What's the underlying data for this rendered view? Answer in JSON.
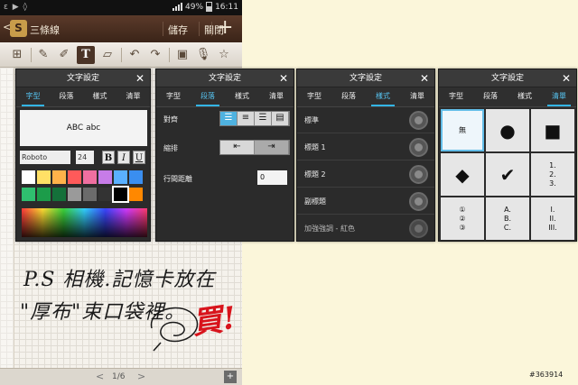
{
  "status_bar": {
    "notifications": "ε ▶ ◊",
    "battery": "49%",
    "time": "16:11"
  },
  "app_bar": {
    "back_glyph": "<",
    "title": "三條線",
    "save_label": "儲存",
    "close_label": "關閉",
    "add_glyph": "+"
  },
  "toolbar": {
    "tools": [
      "insert-page-icon",
      "pen-icon",
      "brush-icon",
      "text-icon",
      "eraser-icon",
      "undo-icon",
      "redo-icon",
      "image-icon",
      "mic-icon",
      "star-icon"
    ],
    "text_tool_glyph": "T"
  },
  "handwriting": {
    "line1": "P.S 相機.記憶卡放在",
    "line2": "\"厚布\"束口袋裡。",
    "exclaim": "買!"
  },
  "pager": {
    "page": "1/6",
    "prev_glyph": "<",
    "next_glyph": ">",
    "add_glyph": "+"
  },
  "dialogs": {
    "title": "文字設定",
    "close_glyph": "✕",
    "tabs": [
      "字型",
      "段落",
      "樣式",
      "清單"
    ]
  },
  "font_panel": {
    "preview_text": "ABC abc",
    "font_name": "Roboto",
    "font_size": "24",
    "bold": "B",
    "italic": "I",
    "underline": "U",
    "swatches": [
      "#ffffff",
      "#ffe066",
      "#ffb24a",
      "#ff5a5a",
      "#f06fa0",
      "#c77ce8",
      "#5ab0ff",
      "#3a8ef0",
      "#2fbf6f",
      "#1c9c4a",
      "#14703a",
      "#9a9a9a",
      "#6b6b6b",
      "#333333",
      "#000000",
      "#ff8800"
    ]
  },
  "paragraph_panel": {
    "align_label": "對齊",
    "indent_label": "縮排",
    "spacing_label": "行間距離",
    "spacing_value": "0"
  },
  "style_panel": {
    "items": [
      "標準",
      "標題 1",
      "標題 2",
      "副標題",
      "加強強調 - 紅色"
    ]
  },
  "list_panel": {
    "none_label": "無",
    "numbered_lines": [
      "1.",
      "2.",
      "3."
    ],
    "circled_lines": [
      "①",
      "②",
      "③"
    ],
    "alpha_lines": [
      "A.",
      "B.",
      "C."
    ],
    "roman_lines": [
      "I.",
      "II.",
      "III."
    ]
  },
  "watermark": "#363914",
  "colors": {
    "accent": "#33b5e5",
    "title_bar": "#4a3326",
    "dialog_bg": "#2b2b2b",
    "exclaim_red": "#d8141c"
  }
}
